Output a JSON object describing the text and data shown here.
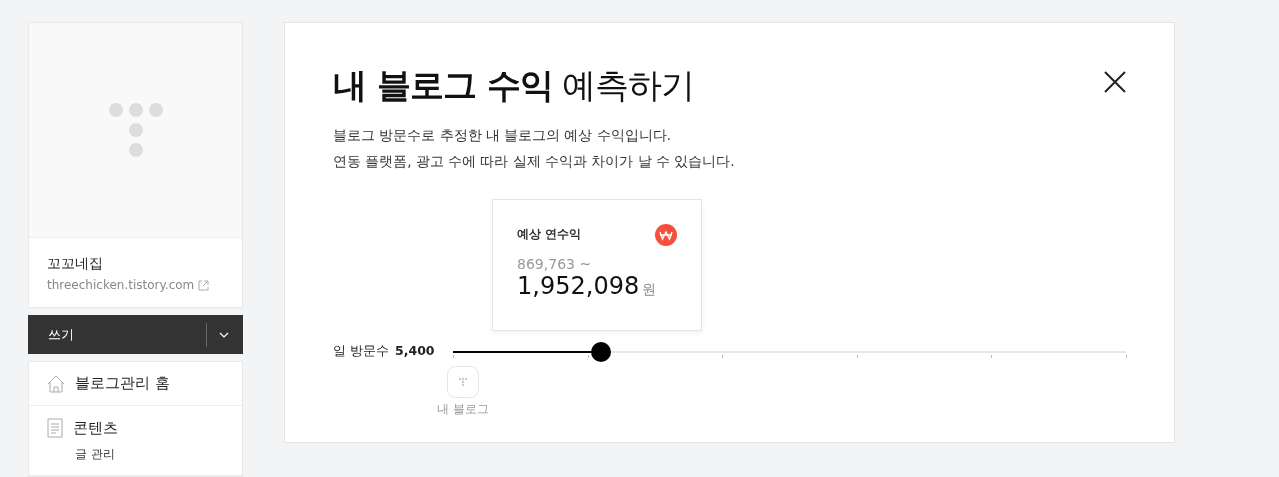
{
  "sidebar": {
    "blog_name": "꼬꼬네집",
    "blog_url": "threechicken.tistory.com",
    "write_button": "쓰기",
    "menu": [
      {
        "label": "블로그관리 홈"
      },
      {
        "label": "콘텐츠",
        "children": [
          {
            "label": "글 관리"
          }
        ]
      }
    ]
  },
  "modal": {
    "title": "**내 블로그 수익** 예측하기",
    "description": [
      "블로그 방문수로 추정한 내 블로그의 예상 수익입니다.",
      "연동 플랫폼, 광고 수에 따라 실제 수익과 차이가 날 수 있습니다."
    ],
    "estimate": {
      "label": "예상 연수익",
      "low": "869,763 ~",
      "high": "1,952,098",
      "unit": "원"
    },
    "slider": {
      "label": "일 방문수",
      "value": "5,400",
      "level": 0.22,
      "marker_label": "내 블로그"
    }
  }
}
